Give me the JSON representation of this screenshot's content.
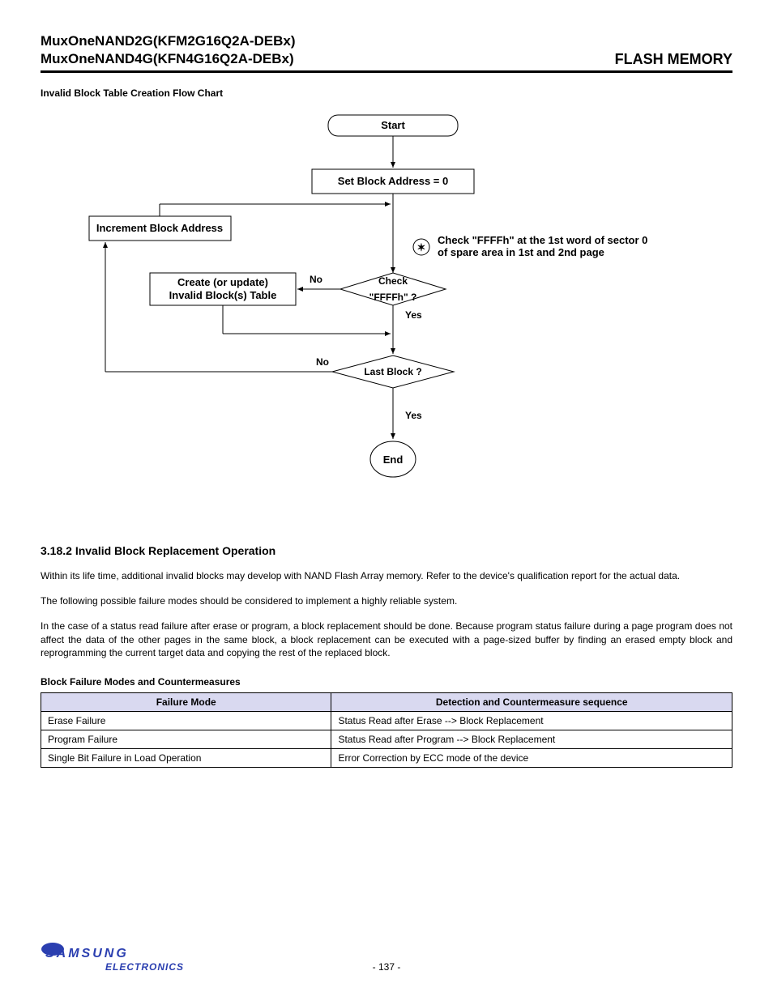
{
  "header": {
    "line1": "MuxOneNAND2G(KFM2G16Q2A-DEBx)",
    "line2": "MuxOneNAND4G(KFN4G16Q2A-DEBx)",
    "right": "FLASH MEMORY"
  },
  "chart_title": "Invalid Block Table Creation Flow Chart",
  "flow": {
    "start": "Start",
    "set_addr": "Set Block Address = 0",
    "increment": "Increment Block Address",
    "create_update_l1": "Create (or update)",
    "create_update_l2": "Invalid Block(s) Table",
    "no1": "No",
    "check_l1": "Check",
    "check_l2": "\"FFFFh\" ?",
    "yes1": "Yes",
    "no2": "No",
    "last_block": "Last Block ?",
    "yes2": "Yes",
    "end": "End",
    "note_l1": "Check \"FFFFh\" at the 1st word of  sector 0",
    "note_l2": "of spare area in 1st and 2nd page",
    "star": "✶"
  },
  "section_heading": "3.18.2 Invalid Block Replacement Operation",
  "para1": "Within its life time, additional invalid blocks may develop with NAND Flash Array memory. Refer to the device's qualification report for the actual data.",
  "para2": "The following possible failure modes should be considered to implement a highly reliable system.",
  "para3": "In the case of a status read failure after erase or program, a block replacement should be done. Because program status failure during a page program does not affect the data of the other pages in the same block, a block replacement can be executed with a page-sized buffer by finding an erased empty block and reprogramming the current target data and copying the rest of the replaced block.",
  "table_title": "Block Failure Modes and Countermeasures",
  "table": {
    "headers": [
      "Failure Mode",
      "Detection and Countermeasure sequence"
    ],
    "rows": [
      [
        "Erase Failure",
        "Status Read after Erase --> Block Replacement"
      ],
      [
        "Program Failure",
        "Status Read after Program --> Block Replacement"
      ],
      [
        "Single Bit Failure in Load Operation",
        "Error Correction by ECC mode of the device"
      ]
    ]
  },
  "page_number": "- 137 -",
  "logo": {
    "brand": "SAMSUNG",
    "sub": "ELECTRONICS"
  }
}
